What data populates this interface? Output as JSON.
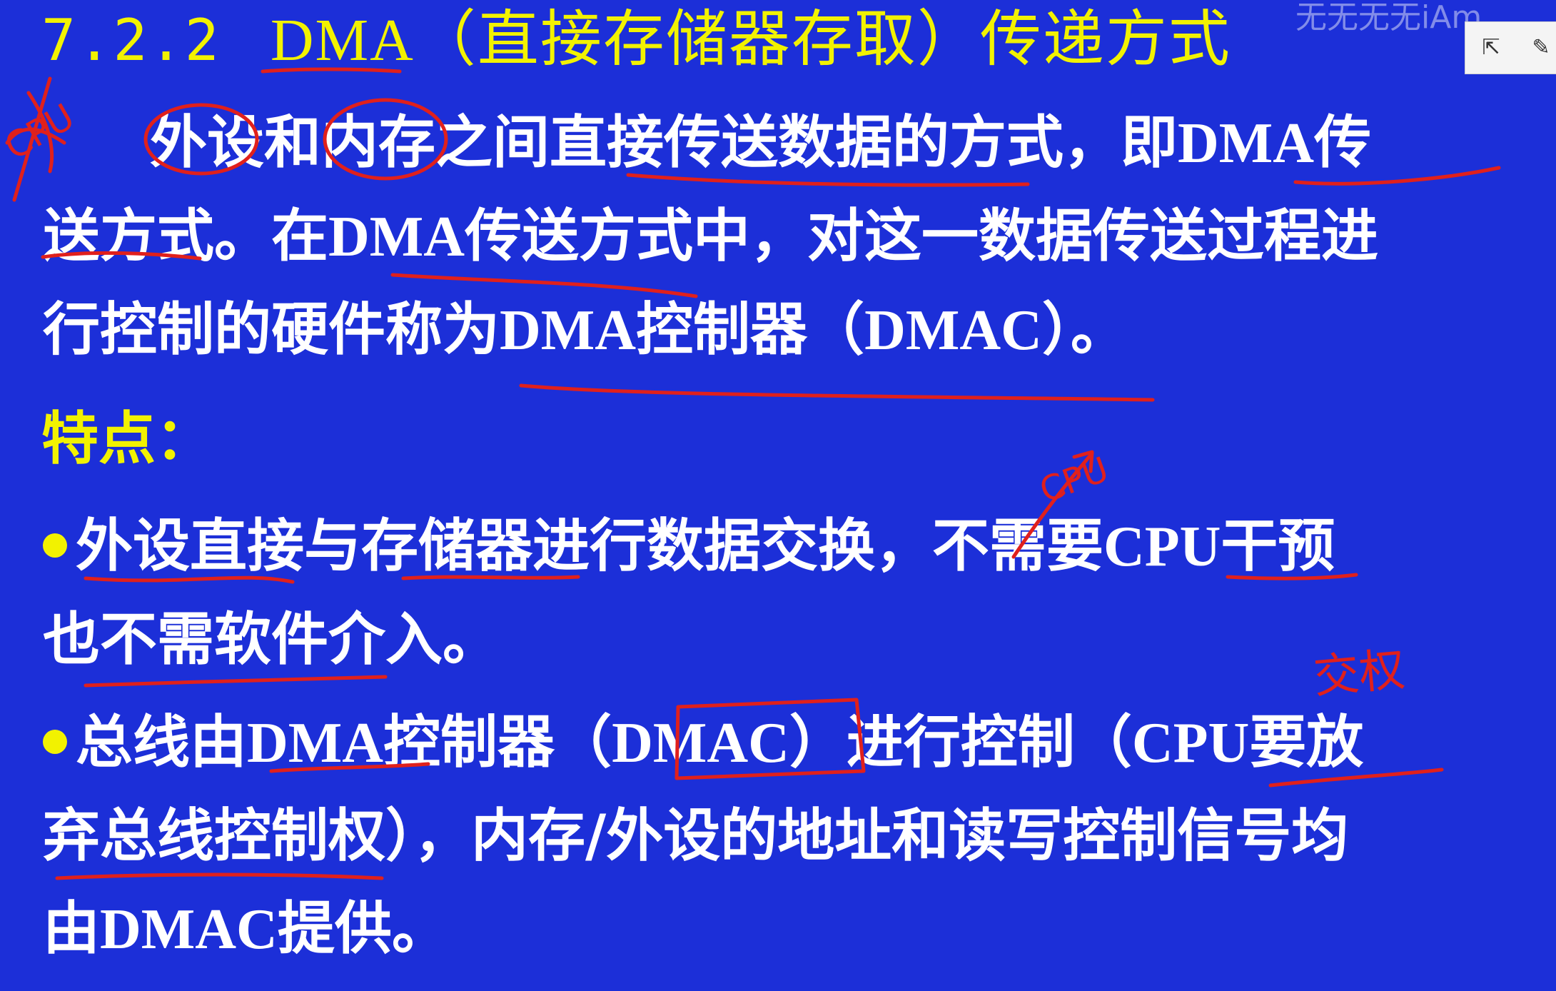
{
  "slide": {
    "title_number": "7.2.2",
    "title_text_a": "DMA",
    "title_text_b": "（直接存储器存取）传递方式",
    "para_line1": "外设和内存之间直接传送数据的方式，即",
    "para_line1_latin": "DMA",
    "para_line1_end": "传",
    "para_line2_a": "送方式。在",
    "para_line2_latin": "DMA",
    "para_line2_b": "传送方式中，对这一数据传送过程进",
    "para_line3_a": "行控制的硬件称为",
    "para_line3_latin": "DMA",
    "para_line3_b": "控制器（",
    "para_line3_latin2": "DMAC",
    "para_line3_c": "）。",
    "features_heading": "特点：",
    "bullet1_line1_a": "外设直接与存储器进行数据交换，不需要",
    "bullet1_line1_latin": "CPU",
    "bullet1_line1_b": "干预",
    "bullet1_line2": "也不需软件介入。",
    "bullet2_line1_a": "总线由",
    "bullet2_line1_latin": "DMA",
    "bullet2_line1_b": "控制器（",
    "bullet2_line1_latin2": "DMAC",
    "bullet2_line1_c": "）进行控制（",
    "bullet2_line1_latin3": "CPU",
    "bullet2_line1_d": "要放",
    "bullet2_line2": "弃总线控制权），内存/外设的地址和读写控制信号均",
    "bullet2_line3_a": "由",
    "bullet2_line3_latin": "DMAC",
    "bullet2_line3_b": "提供。"
  },
  "annotations": {
    "ink_color": "#e0201c",
    "handwritten_1": "CPU",
    "handwritten_2": "CPU",
    "handwritten_3": "交权"
  },
  "overlay": {
    "watermark": "无无无无iAm",
    "toolbar_icons": [
      "pointer-icon",
      "pen-icon"
    ]
  },
  "colors": {
    "background": "#1c2fd8",
    "title": "#f2f200",
    "body": "#ffffff",
    "bullet": "#f2f200"
  }
}
